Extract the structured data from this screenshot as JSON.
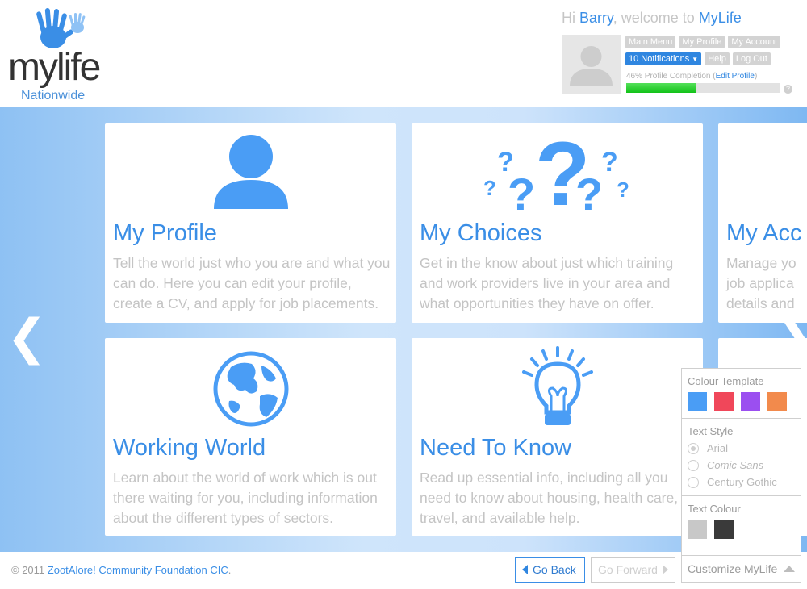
{
  "header": {
    "logo_word": "mylife",
    "logo_sub": "Nationwide",
    "welcome_hi": "Hi",
    "welcome_name": "Barry",
    "welcome_mid": ", welcome to",
    "welcome_brand": "MyLife",
    "buttons_row1": [
      "Main Menu",
      "My Profile",
      "My Account"
    ],
    "notifications": "10 Notifications",
    "help": "Help",
    "logout": "Log Out",
    "completion_text": "46% Profile Completion (",
    "edit_profile": "Edit Profile",
    "completion_close": ")",
    "profile_completion": 0.46,
    "help_icon_text": "?"
  },
  "tiles": [
    {
      "title": "My Profile",
      "desc": "Tell the world just who you are and what you can do. Here you can edit your profile, create a CV, and apply for job placements.",
      "icon": "person-icon"
    },
    {
      "title": "My Choices",
      "desc": "Get in the know about just which training and work providers live in your area and what opportunities they have on offer.",
      "icon": "question-marks-icon"
    },
    {
      "title": "My Acc",
      "desc": "Manage yo job applica details and",
      "icon": "account-icon"
    },
    {
      "title": "Working World",
      "desc": "Learn about the world of work which is out there waiting for you, including information about the different types of sectors.",
      "icon": "globe-icon"
    },
    {
      "title": "Need To Know",
      "desc": "Read up essential info, including all you need to know about housing, health care, travel, and available help.",
      "icon": "lightbulb-icon"
    }
  ],
  "nav": {
    "prev_arrow": "❮",
    "next_arrow": "❯"
  },
  "footer": {
    "copyright_prefix": "© 2011",
    "copyright_link": "ZootAlore! Community Foundation CIC",
    "copyright_suffix": ".",
    "go_back": "Go Back",
    "go_forward": "Go Forward"
  },
  "customize": {
    "colour_template_label": "Colour Template",
    "colour_templates": [
      "#4a9df5",
      "#f0475a",
      "#9b4ff0",
      "#f28a4c"
    ],
    "text_style_label": "Text Style",
    "text_styles": [
      "Arial",
      "Comic Sans",
      "Century Gothic"
    ],
    "text_colour_label": "Text Colour",
    "text_colours": [
      "#c8c8c8",
      "#3a3a3a"
    ],
    "button_label": "Customize MyLife"
  }
}
